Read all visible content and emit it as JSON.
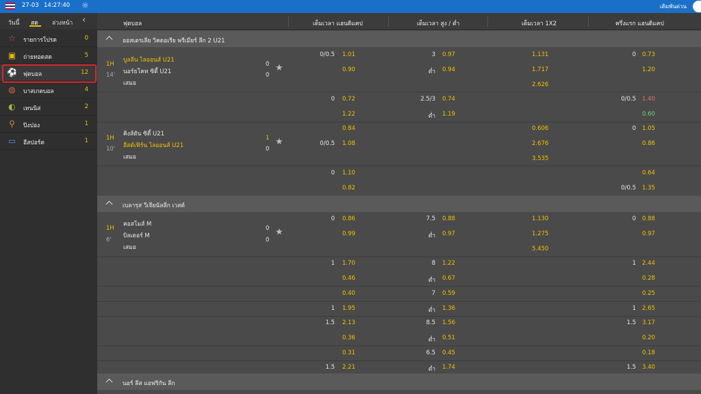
{
  "topbar": {
    "date": "27-03",
    "time": "14:27:40",
    "quick_bet": "เดิมพันด่วน"
  },
  "sidebar": {
    "tabs": [
      "วันนี้",
      "สด",
      "ล่วงหน้า"
    ],
    "items": [
      {
        "label": "รายการโปรด",
        "count": "0",
        "icon": "star-icon"
      },
      {
        "label": "ถ่ายทอดสด",
        "count": "5",
        "icon": "tv-icon"
      },
      {
        "label": "ฟุตบอล",
        "count": "12",
        "icon": "soccer-ball-icon"
      },
      {
        "label": "บาสเกตบอล",
        "count": "4",
        "icon": "basketball-icon"
      },
      {
        "label": "เทนนิส",
        "count": "2",
        "icon": "tennis-icon"
      },
      {
        "label": "ปิงปอง",
        "count": "1",
        "icon": "table-tennis-icon"
      },
      {
        "label": "อีสปอร์ต",
        "count": "1",
        "icon": "gamepad-icon"
      }
    ]
  },
  "header": {
    "sport": "ฟุตบอล",
    "col1": "เต็มเวลา แฮนดิแคป",
    "col2": "เต็มเวลา สูง / ต่ำ",
    "col3": "เต็มเวลา 1X2",
    "col4": "ครึ่งแรก แฮนดิแคป"
  },
  "leagues": [
    {
      "name": "ออสเตรเลีย วิคตอเรีย พรีเมียร์ ลีก 2 U21"
    },
    {
      "name": "เบลารุส วีเจียนัลลีก เวสต์"
    },
    {
      "name": "นอร์ ลีส แอฟริกัน ลีก"
    }
  ],
  "matches": [
    {
      "period": "1H",
      "minute": "14'",
      "home": "บูลลีน ไลออนส์ U21",
      "away": "นอร์ธโคท ซิตี้ U21",
      "draw": "เสมอ",
      "home_score": "0",
      "away_score": "0",
      "main": {
        "hdp1": "0/0.5",
        "hdp1_odds": "1.01",
        "hdp2_odds": "0.90",
        "ou_line": "3",
        "ou_over": "0.97",
        "ou_under_label": "ต่ำ",
        "ou_under": "0.94",
        "x1": "1.131",
        "x2": "1.717",
        "xd": "2.626",
        "fh_line": "0",
        "fh1": "0.73",
        "fh2": "1.20"
      },
      "extra": {
        "hdp": "0",
        "h1": "0.72",
        "h2": "1.22",
        "ou_line": "2.5/3",
        "o1": "0.74",
        "u_label": "ต่ำ",
        "o2": "1.19",
        "fh_line": "0/0.5",
        "fh1": "1.40",
        "fh2": "0.60"
      }
    },
    {
      "period": "1H",
      "minute": "10'",
      "home": "คิงส์ตัน ซิตี้ U21",
      "away": "อีสต์เฟิร์น ไลออนส์ U21",
      "draw": "เสมอ",
      "home_score": "1",
      "away_score": "0",
      "main": {
        "h1": "0.84",
        "hdp2": "0/0.5",
        "h2": "1.08",
        "x1": "0.606",
        "x2": "2.676",
        "xd": "3.535",
        "fh_line": "0",
        "fh1": "1.05",
        "fh2": "0.86"
      },
      "extra": {
        "hdp": "0",
        "h1": "1.10",
        "h2": "0.82",
        "fh1": "0.64",
        "fh_line": "0/0.5",
        "fh2": "1.35"
      }
    },
    {
      "period": "1H",
      "minute": "6'",
      "home": "คอสโมส์ M",
      "away": "บิลเดอร์ M",
      "draw": "เสมอ",
      "home_score": "0",
      "away_score": "0",
      "main": {
        "hdp": "0",
        "h1": "0.86",
        "h2": "0.99",
        "ou_line": "7.5",
        "o1": "0.88",
        "u_label": "ต่ำ",
        "o2": "0.97",
        "x1": "1.130",
        "x2": "1.275",
        "xd": "5.450",
        "fh_line": "0",
        "fh1": "0.88",
        "fh2": "0.97"
      }
    }
  ],
  "extra_lines": [
    {
      "hdp": "1",
      "h1": "1.70",
      "h2": "0.46",
      "ou": "8",
      "o1": "1.22",
      "ul": "ต่ำ",
      "o2": "0.67",
      "fl": "1",
      "f1": "2.44",
      "f2": "0.28"
    },
    {
      "hdp": "",
      "h1": "0.40",
      "h2": "",
      "ou": "7",
      "o1": "0.59",
      "ul": "",
      "o2": "",
      "fl": "",
      "f1": "0.25",
      "f2": ""
    },
    {
      "hdp": "1",
      "h1": "1.95",
      "h2": "",
      "ou": "",
      "o1": "",
      "ul": "ต่ำ",
      "o2": "1.36",
      "fl": "1",
      "f1": "2.65",
      "f2": ""
    },
    {
      "hdp": "1.5",
      "h1": "2.13",
      "h2": "0.36",
      "ou": "8.5",
      "o1": "1.56",
      "ul": "ต่ำ",
      "o2": "0.51",
      "fl": "1.5",
      "f1": "3.17",
      "f2": "0.20"
    },
    {
      "hdp": "",
      "h1": "0.31",
      "h2": "",
      "ou": "6.5",
      "o1": "0.45",
      "ul": "",
      "o2": "",
      "fl": "",
      "f1": "0.18",
      "f2": ""
    },
    {
      "hdp": "1.5",
      "h1": "2.21",
      "h2": "",
      "ou": "",
      "o1": "",
      "ul": "ต่ำ",
      "o2": "1.74",
      "fl": "1.5",
      "f1": "3.40",
      "f2": ""
    }
  ],
  "colors": {
    "accent": "#f2c200",
    "topbar": "#1a70c8",
    "highlight_border": "#d9262b"
  }
}
